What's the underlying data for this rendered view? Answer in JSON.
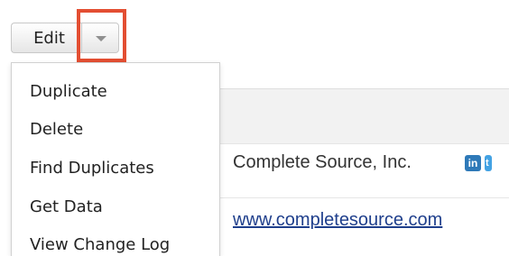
{
  "toolbar": {
    "edit_label": "Edit"
  },
  "dropdown_menu": {
    "items": [
      {
        "label": "Duplicate"
      },
      {
        "label": "Delete"
      },
      {
        "label": "Find Duplicates"
      },
      {
        "label": "Get Data"
      },
      {
        "label": "View Change Log"
      }
    ]
  },
  "record": {
    "account_name": "Complete Source, Inc.",
    "website": "www.completesource.com",
    "social_icons": [
      "linkedin-icon",
      "twitter-icon"
    ]
  },
  "colors": {
    "highlight": "#e34e32",
    "link": "#1f3f8c",
    "linkedin": "#2e79b8",
    "twitter": "#43a2e3"
  }
}
